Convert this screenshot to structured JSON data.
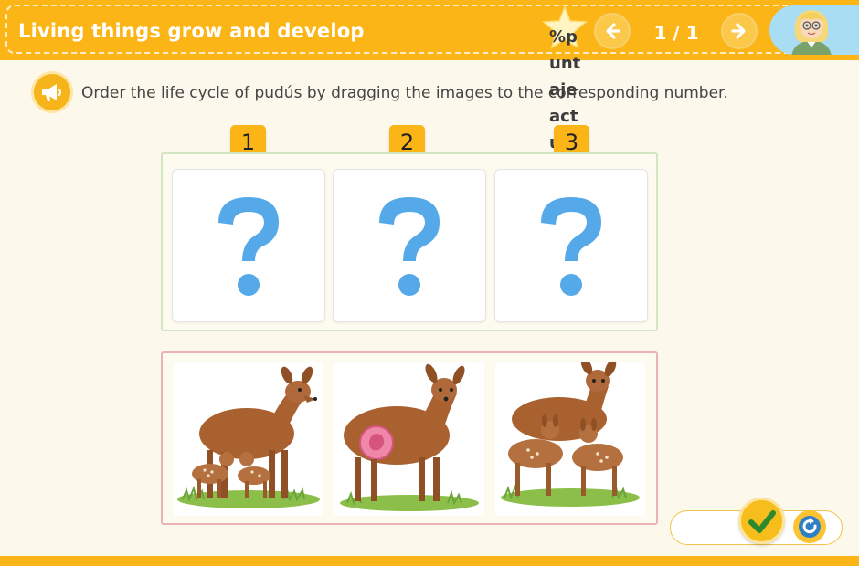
{
  "header": {
    "title": "Living things grow and develop",
    "score_text": "%p\nunt\naje\nact\nual",
    "page_indicator": "1 / 1"
  },
  "instruction": {
    "text": "Order the life cycle of pudús by dragging the images to the corresponding number."
  },
  "slots": [
    {
      "number": "1",
      "icon": "question-mark-icon"
    },
    {
      "number": "2",
      "icon": "question-mark-icon"
    },
    {
      "number": "3",
      "icon": "question-mark-icon"
    }
  ],
  "cards": [
    {
      "icon": "doe-with-two-fawns-image"
    },
    {
      "icon": "pregnant-doe-image"
    },
    {
      "icon": "doe-with-two-young-deer-image"
    }
  ],
  "colors": {
    "accent": "#fbb516",
    "question_mark": "#56a9e8",
    "drop_zone_border": "#d3e6c3",
    "source_zone_border": "#eab3b3"
  }
}
